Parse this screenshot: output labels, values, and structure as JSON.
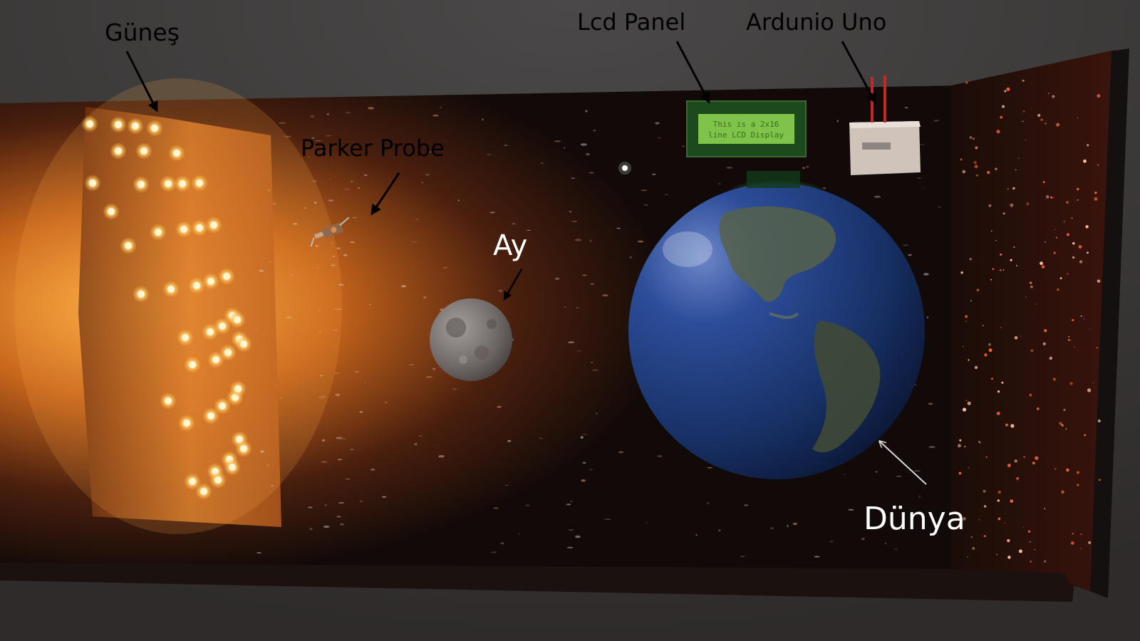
{
  "labels": {
    "sun": "Güneş",
    "probe": "Parker Probe",
    "moon": "Ay",
    "lcd": "Lcd Panel",
    "arduino": "Ardunio Uno",
    "earth": "Dünya"
  },
  "lcd_screen": {
    "line1": "This is a 2x16",
    "line2": "line LCD Display"
  },
  "colors": {
    "background": "#3c3a39",
    "space": "#0d0908",
    "sun_glow": "#ffb347",
    "led": "#fff3c4",
    "lcd_green": "#7fc34a",
    "earth_ocean": "#1f3c7a",
    "moon": "#8c8685"
  }
}
